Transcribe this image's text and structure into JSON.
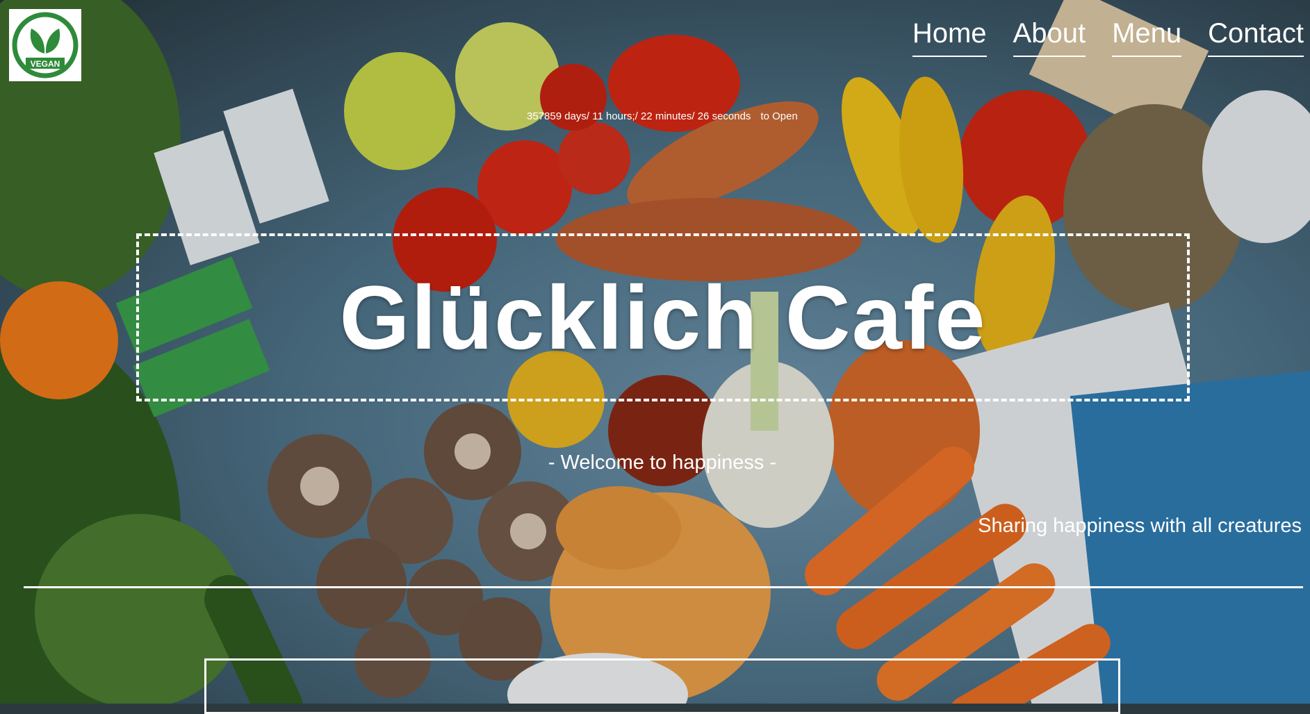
{
  "logo": {
    "text": "VEGAN",
    "icon": "leaf-icon",
    "color": "#2e8b3a"
  },
  "nav": {
    "items": [
      {
        "label": "Home"
      },
      {
        "label": "About"
      },
      {
        "label": "Menu"
      },
      {
        "label": "Contact"
      }
    ]
  },
  "countdown": {
    "time": "357859 days/ 11 hours;/ 22 minutes/ 26 seconds",
    "suffix": "to Open"
  },
  "hero": {
    "title": "Glücklich Cafe",
    "tagline": "- Welcome to happiness -",
    "subtitle": "Sharing happiness with all creatures"
  }
}
